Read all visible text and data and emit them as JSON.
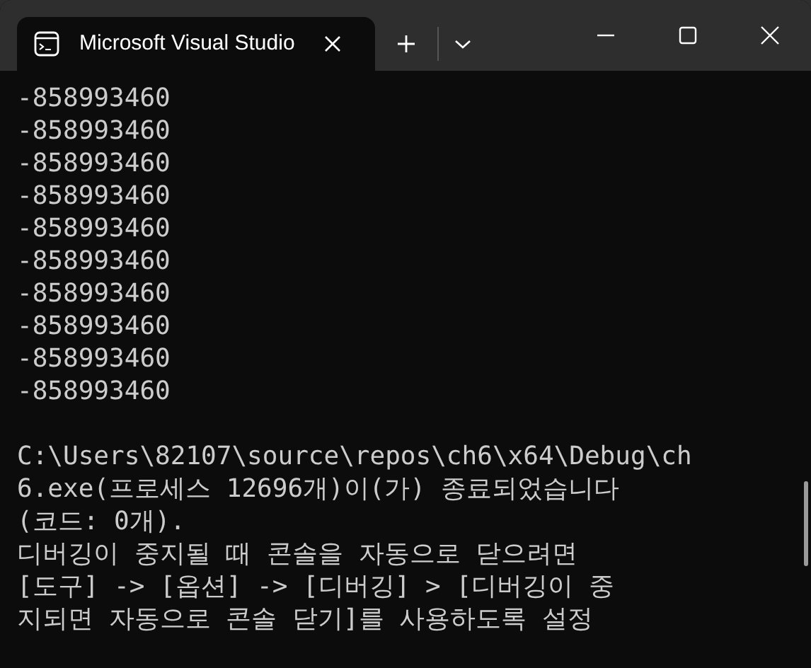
{
  "window": {
    "tab_title": "Microsoft Visual Studio",
    "tab_selected": true
  },
  "console": {
    "values": [
      "-858993460",
      "-858993460",
      "-858993460",
      "-858993460",
      "-858993460",
      "-858993460",
      "-858993460",
      "-858993460",
      "-858993460",
      "-858993460"
    ],
    "message_lines": [
      "C:\\Users\\82107\\source\\repos\\ch6\\x64\\Debug\\ch",
      "6.exe(프로세스 12696개)이(가) 종료되었습니다",
      "(코드: 0개).",
      "디버깅이 중지될 때 콘솔을 자동으로 닫으려면",
      "[도구] -> [옵션] -> [디버깅] > [디버깅이 중",
      "지되면 자동으로 콘솔 닫기]를 사용하도록 설정"
    ]
  }
}
